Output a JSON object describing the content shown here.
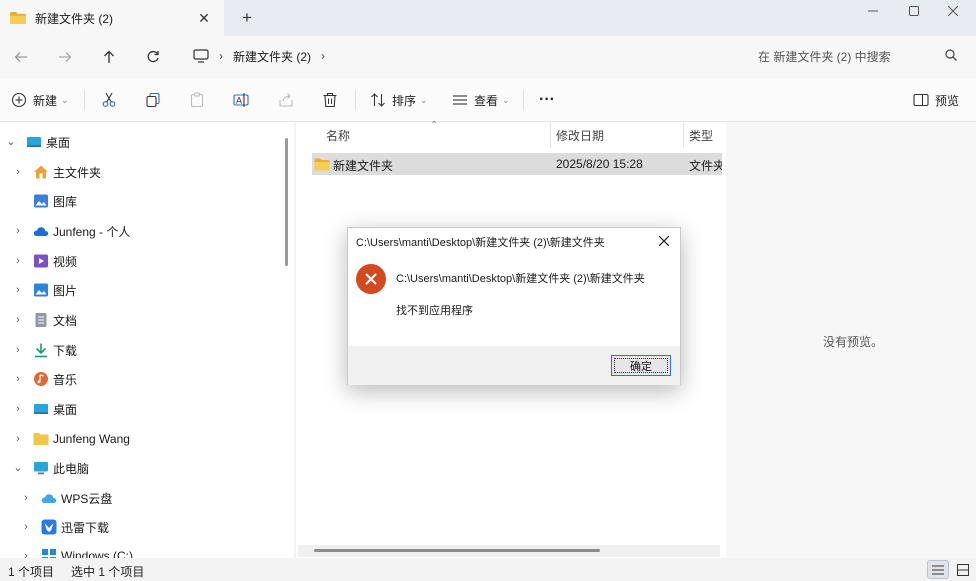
{
  "window": {
    "tab_title": "新建文件夹 (2)",
    "new_tab_label": "+"
  },
  "address": {
    "crumb": "新建文件夹 (2)",
    "search_placeholder": "在 新建文件夹 (2) 中搜索"
  },
  "toolbar": {
    "new_label": "新建",
    "sort_label": "排序",
    "view_label": "查看",
    "more_label": "···",
    "preview_label": "预览"
  },
  "sidebar": {
    "items": [
      {
        "label": "桌面",
        "icon": "desktop-icon"
      },
      {
        "label": "主文件夹",
        "icon": "home-icon"
      },
      {
        "label": "图库",
        "icon": "gallery-icon"
      },
      {
        "label": "Junfeng - 个人",
        "icon": "cloud-icon"
      },
      {
        "label": "视频",
        "icon": "video-icon"
      },
      {
        "label": "图片",
        "icon": "pictures-icon"
      },
      {
        "label": "文档",
        "icon": "documents-icon"
      },
      {
        "label": "下载",
        "icon": "download-icon"
      },
      {
        "label": "音乐",
        "icon": "music-icon"
      },
      {
        "label": "桌面",
        "icon": "desktop-icon"
      },
      {
        "label": "Junfeng Wang",
        "icon": "folder-icon"
      },
      {
        "label": "此电脑",
        "icon": "computer-icon"
      },
      {
        "label": "WPS云盘",
        "icon": "wps-cloud-icon"
      },
      {
        "label": "迅雷下载",
        "icon": "thunder-icon"
      },
      {
        "label": "Windows (C:)",
        "icon": "drive-icon"
      }
    ]
  },
  "columns": {
    "name": "名称",
    "modified": "修改日期",
    "type": "类型"
  },
  "files": [
    {
      "name": "新建文件夹",
      "modified": "2025/8/20 15:28",
      "type": "文件夹"
    }
  ],
  "preview": {
    "empty_text": "没有预览。"
  },
  "status": {
    "count": "1 个项目",
    "selected": "选中 1 个项目"
  },
  "dialog": {
    "title": "C:\\Users\\manti\\Desktop\\新建文件夹 (2)\\新建文件夹",
    "path": "C:\\Users\\manti\\Desktop\\新建文件夹 (2)\\新建文件夹",
    "message": "找不到应用程序",
    "ok_label": "确定"
  },
  "colors": {
    "accent": "#2f6fd6",
    "error": "#d24a20",
    "folder": "#f2c54b",
    "selection": "#dcdcdc"
  }
}
